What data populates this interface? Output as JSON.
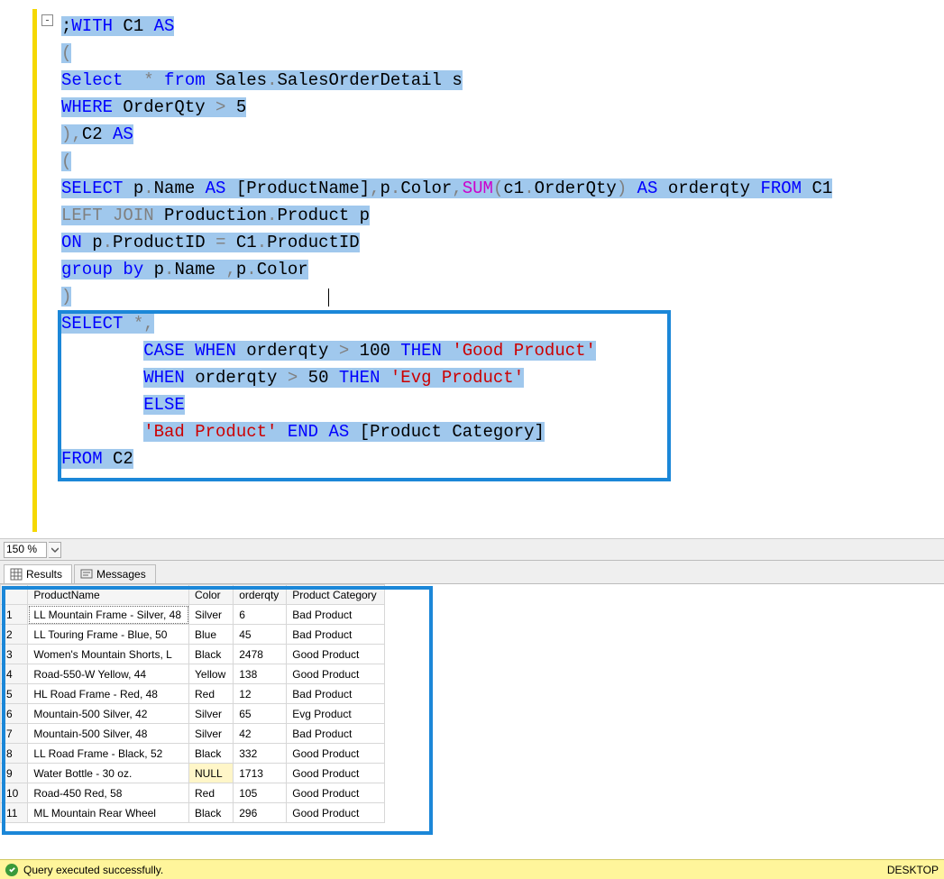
{
  "zoom": {
    "value": "150 %"
  },
  "fold": "-",
  "code": {
    "l1": [
      {
        "t": ";",
        "c": "plain"
      },
      {
        "t": "WITH",
        "c": "kw"
      },
      {
        "t": " C1 ",
        "c": "plain"
      },
      {
        "t": "AS",
        "c": "kw"
      }
    ],
    "l2": [
      {
        "t": "(",
        "c": "gry"
      }
    ],
    "l3": [
      {
        "t": "Select",
        "c": "kw"
      },
      {
        "t": "  ",
        "c": "plain"
      },
      {
        "t": "*",
        "c": "gry"
      },
      {
        "t": " ",
        "c": "plain"
      },
      {
        "t": "from",
        "c": "kw"
      },
      {
        "t": " Sales",
        "c": "plain"
      },
      {
        "t": ".",
        "c": "gry"
      },
      {
        "t": "SalesOrderDetail s",
        "c": "plain"
      }
    ],
    "l4": [
      {
        "t": "WHERE",
        "c": "kw"
      },
      {
        "t": " OrderQty ",
        "c": "plain"
      },
      {
        "t": ">",
        "c": "gry"
      },
      {
        "t": " 5",
        "c": "plain"
      }
    ],
    "l5": [
      {
        "t": "),",
        "c": "gry"
      },
      {
        "t": "C2 ",
        "c": "plain"
      },
      {
        "t": "AS",
        "c": "kw"
      }
    ],
    "l6": [
      {
        "t": "(",
        "c": "gry"
      }
    ],
    "l7": [
      {
        "t": "SELECT",
        "c": "kw"
      },
      {
        "t": " p",
        "c": "plain"
      },
      {
        "t": ".",
        "c": "gry"
      },
      {
        "t": "Name ",
        "c": "plain"
      },
      {
        "t": "AS",
        "c": "kw"
      },
      {
        "t": " [ProductName]",
        "c": "plain"
      },
      {
        "t": ",",
        "c": "gry"
      },
      {
        "t": "p",
        "c": "plain"
      },
      {
        "t": ".",
        "c": "gry"
      },
      {
        "t": "Color",
        "c": "plain"
      },
      {
        "t": ",",
        "c": "gry"
      },
      {
        "t": "SUM",
        "c": "func"
      },
      {
        "t": "(",
        "c": "gry"
      },
      {
        "t": "c1",
        "c": "plain"
      },
      {
        "t": ".",
        "c": "gry"
      },
      {
        "t": "OrderQty",
        "c": "plain"
      },
      {
        "t": ")",
        "c": "gry"
      },
      {
        "t": " ",
        "c": "plain"
      },
      {
        "t": "AS",
        "c": "kw"
      },
      {
        "t": " orderqty ",
        "c": "plain"
      },
      {
        "t": "FROM",
        "c": "kw"
      },
      {
        "t": " C1",
        "c": "plain"
      }
    ],
    "l8": [
      {
        "t": "LEFT",
        "c": "gry"
      },
      {
        "t": " ",
        "c": "plain"
      },
      {
        "t": "JOIN",
        "c": "gry"
      },
      {
        "t": " Production",
        "c": "plain"
      },
      {
        "t": ".",
        "c": "gry"
      },
      {
        "t": "Product p",
        "c": "plain"
      }
    ],
    "l9": [
      {
        "t": "ON",
        "c": "kw"
      },
      {
        "t": " p",
        "c": "plain"
      },
      {
        "t": ".",
        "c": "gry"
      },
      {
        "t": "ProductID ",
        "c": "plain"
      },
      {
        "t": "=",
        "c": "gry"
      },
      {
        "t": " C1",
        "c": "plain"
      },
      {
        "t": ".",
        "c": "gry"
      },
      {
        "t": "ProductID",
        "c": "plain"
      }
    ],
    "l10": [
      {
        "t": "group",
        "c": "kw"
      },
      {
        "t": " ",
        "c": "plain"
      },
      {
        "t": "by",
        "c": "kw"
      },
      {
        "t": " p",
        "c": "plain"
      },
      {
        "t": ".",
        "c": "gry"
      },
      {
        "t": "Name ",
        "c": "plain"
      },
      {
        "t": ",",
        "c": "gry"
      },
      {
        "t": "p",
        "c": "plain"
      },
      {
        "t": ".",
        "c": "gry"
      },
      {
        "t": "Color",
        "c": "plain"
      }
    ],
    "l11": [
      {
        "t": ")",
        "c": "gry"
      }
    ],
    "l12": [
      {
        "t": "SELECT",
        "c": "kw"
      },
      {
        "t": " ",
        "c": "plain"
      },
      {
        "t": "*,",
        "c": "gry"
      }
    ],
    "l13": [
      {
        "t": "        ",
        "c": "plain",
        "nohl": true
      },
      {
        "t": "CASE",
        "c": "kw"
      },
      {
        "t": " ",
        "c": "plain"
      },
      {
        "t": "WHEN",
        "c": "kw"
      },
      {
        "t": " orderqty ",
        "c": "plain"
      },
      {
        "t": ">",
        "c": "gry"
      },
      {
        "t": " 100 ",
        "c": "plain"
      },
      {
        "t": "THEN",
        "c": "kw"
      },
      {
        "t": " ",
        "c": "plain"
      },
      {
        "t": "'Good Product'",
        "c": "str"
      }
    ],
    "l14": [
      {
        "t": "        ",
        "c": "plain",
        "nohl": true
      },
      {
        "t": "WHEN",
        "c": "kw"
      },
      {
        "t": " orderqty ",
        "c": "plain"
      },
      {
        "t": ">",
        "c": "gry"
      },
      {
        "t": " 50 ",
        "c": "plain"
      },
      {
        "t": "THEN",
        "c": "kw"
      },
      {
        "t": " ",
        "c": "plain"
      },
      {
        "t": "'Evg Product'",
        "c": "str"
      }
    ],
    "l15": [
      {
        "t": "        ",
        "c": "plain",
        "nohl": true
      },
      {
        "t": "ELSE",
        "c": "kw"
      }
    ],
    "l16": [
      {
        "t": "        ",
        "c": "plain",
        "nohl": true
      },
      {
        "t": "'Bad Product'",
        "c": "str"
      },
      {
        "t": " ",
        "c": "plain"
      },
      {
        "t": "END",
        "c": "kw"
      },
      {
        "t": " ",
        "c": "plain"
      },
      {
        "t": "AS",
        "c": "kw"
      },
      {
        "t": " [Product Category]",
        "c": "plain"
      }
    ],
    "l17": [
      {
        "t": "FROM",
        "c": "kw"
      },
      {
        "t": " C2",
        "c": "plain"
      }
    ]
  },
  "tabs": {
    "results": "Results",
    "messages": "Messages"
  },
  "grid": {
    "headers": [
      "ProductName",
      "Color",
      "orderqty",
      "Product Category"
    ],
    "rows": [
      {
        "n": "1",
        "c": [
          "LL Mountain Frame - Silver, 48",
          "Silver",
          "6",
          "Bad Product"
        ],
        "sel": true
      },
      {
        "n": "2",
        "c": [
          "LL Touring Frame - Blue, 50",
          "Blue",
          "45",
          "Bad Product"
        ]
      },
      {
        "n": "3",
        "c": [
          "Women's Mountain Shorts, L",
          "Black",
          "2478",
          "Good Product"
        ]
      },
      {
        "n": "4",
        "c": [
          "Road-550-W Yellow, 44",
          "Yellow",
          "138",
          "Good Product"
        ]
      },
      {
        "n": "5",
        "c": [
          "HL Road Frame - Red, 48",
          "Red",
          "12",
          "Bad Product"
        ]
      },
      {
        "n": "6",
        "c": [
          "Mountain-500 Silver, 42",
          "Silver",
          "65",
          "Evg Product"
        ]
      },
      {
        "n": "7",
        "c": [
          "Mountain-500 Silver, 48",
          "Silver",
          "42",
          "Bad Product"
        ]
      },
      {
        "n": "8",
        "c": [
          "LL Road Frame - Black, 52",
          "Black",
          "332",
          "Good Product"
        ]
      },
      {
        "n": "9",
        "c": [
          "Water Bottle - 30 oz.",
          "NULL",
          "1713",
          "Good Product"
        ],
        "null_col": 1
      },
      {
        "n": "10",
        "c": [
          "Road-450 Red, 58",
          "Red",
          "105",
          "Good Product"
        ]
      },
      {
        "n": "11",
        "c": [
          "ML Mountain Rear Wheel",
          "Black",
          "296",
          "Good Product"
        ]
      }
    ]
  },
  "status": {
    "message": "Query executed successfully.",
    "right": "DESKTOP"
  }
}
